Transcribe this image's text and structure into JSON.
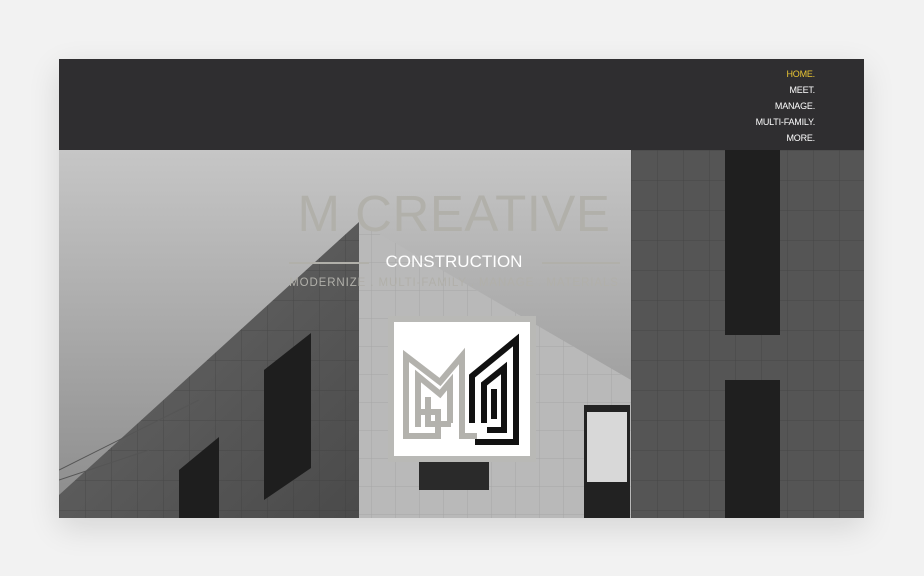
{
  "nav": {
    "items": [
      {
        "label": "HOME.",
        "active": true
      },
      {
        "label": "MEET."
      },
      {
        "label": "MANAGE."
      },
      {
        "label": "MULTI-FAMILY."
      },
      {
        "label": "MORE."
      }
    ],
    "active_color": "#e9c534"
  },
  "hero": {
    "title": "M CREATIVE",
    "subtitle": "CONSTRUCTION",
    "tagline": "MODERNIZE . MULTI-FAMILY . MANAGE . MATERIALS",
    "logo_icon": "mc-monogram-logo"
  },
  "colors": {
    "topbar": "#2f2e30",
    "title": "#b1b0aa",
    "accent": "#e9c534"
  }
}
